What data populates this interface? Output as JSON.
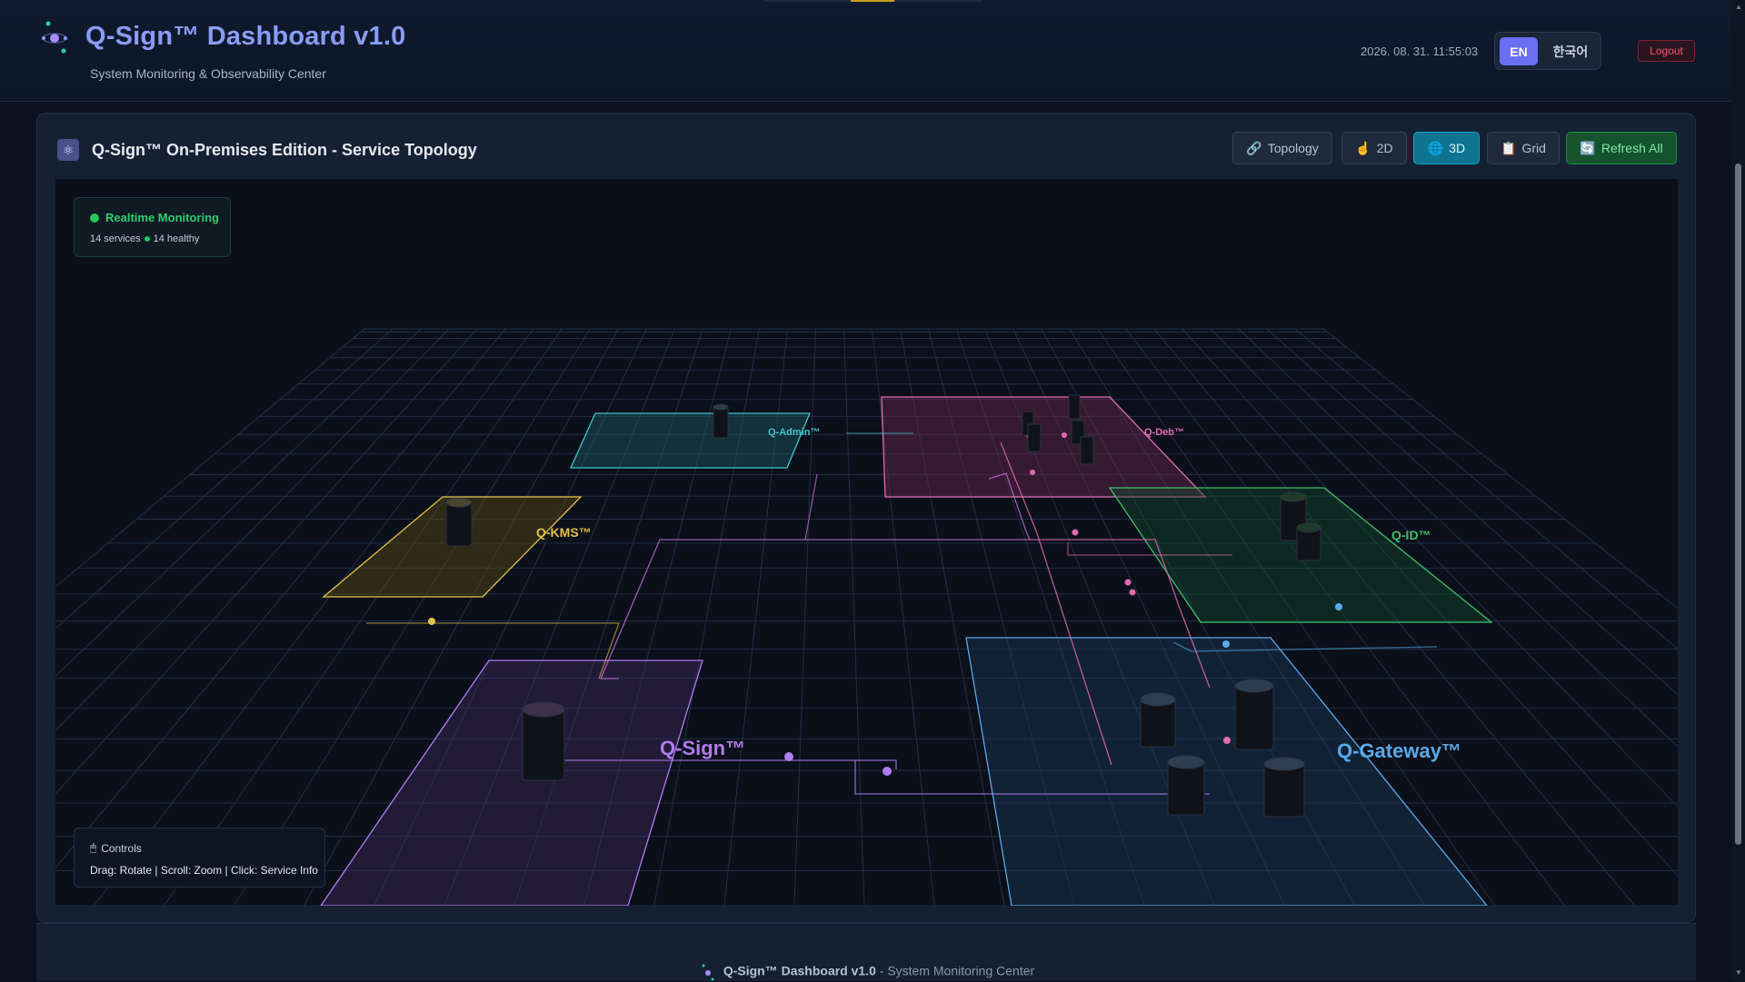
{
  "header": {
    "title": "Q-Sign™ Dashboard v1.0",
    "subtitle": "System Monitoring & Observability Center",
    "datetime": "2026. 08. 31. 11:55:03",
    "lang_en": "EN",
    "lang_ko": "한국어",
    "logout": "Logout"
  },
  "panel": {
    "title": "Q-Sign™ On-Premises Edition - Service Topology",
    "buttons": {
      "topology": "Topology",
      "two_d": "2D",
      "three_d": "3D",
      "grid": "Grid",
      "refresh": "Refresh All"
    },
    "icons": {
      "topology": "link-icon",
      "two_d": "pointer-icon",
      "three_d": "globe-icon",
      "grid": "clipboard-icon",
      "refresh": "refresh-icon"
    },
    "active_view": "3D"
  },
  "status": {
    "title": "Realtime Monitoring",
    "services": "14 services",
    "healthy": "14 healthy"
  },
  "controls": {
    "title": "Controls",
    "detail": "Drag: Rotate | Scroll: Zoom | Click: Service Info"
  },
  "zones": {
    "qsign": "Q-Sign™",
    "qgateway": "Q-Gateway™",
    "qkms": "Q-KMS™",
    "qadmin": "Q-Admin™",
    "qdeb": "Q-Deb™",
    "qid": "Q-ID™"
  },
  "colors": {
    "qsign": "#b07cf0",
    "qgateway": "#5aa9e6",
    "qkms": "#e3c04a",
    "qadmin": "#3ec6c9",
    "qdeb": "#e26bb0",
    "qid": "#3fbf6a",
    "accent": "#6a6ff2",
    "healthy": "#22c55e"
  },
  "footer": {
    "brand": "Q-Sign™ Dashboard v1.0",
    "text": " - System Monitoring Center"
  }
}
